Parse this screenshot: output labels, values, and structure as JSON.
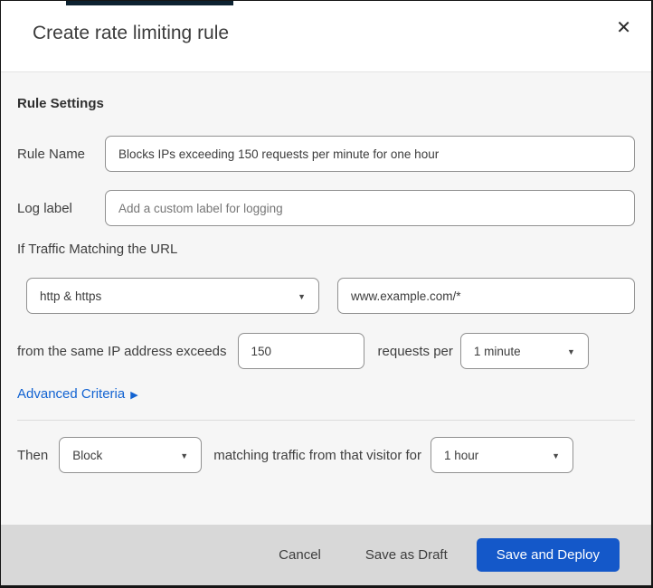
{
  "header": {
    "title": "Create rate limiting rule"
  },
  "icons": {
    "close": "✕",
    "caret_down": "▼",
    "arrow_right": "▶"
  },
  "sections": {
    "rule_settings_heading": "Rule Settings",
    "rule_name": {
      "label": "Rule Name",
      "value": "Blocks IPs exceeding 150 requests per minute for one hour"
    },
    "log_label": {
      "label": "Log label",
      "placeholder": "Add a custom label for logging"
    },
    "traffic_match": {
      "heading": "If Traffic Matching the URL",
      "protocol_selected": "http & https",
      "url_value": "www.example.com/*"
    },
    "threshold": {
      "prefix": "from the same IP address exceeds",
      "requests_value": "150",
      "middle": "requests per",
      "period_selected": "1 minute"
    },
    "advanced_criteria": {
      "label": "Advanced Criteria"
    },
    "action": {
      "prefix": "Then",
      "action_selected": "Block",
      "middle": "matching traffic from that visitor for",
      "duration_selected": "1 hour"
    }
  },
  "footer": {
    "cancel_label": "Cancel",
    "save_draft_label": "Save as Draft",
    "save_deploy_label": "Save and Deploy"
  },
  "colors": {
    "primary_button_blue": "#1458c9",
    "link_blue": "#1263d2",
    "body_bg": "#f6f6f6",
    "footer_bg": "#d8d8d8",
    "top_artifact": "#0d2231"
  }
}
